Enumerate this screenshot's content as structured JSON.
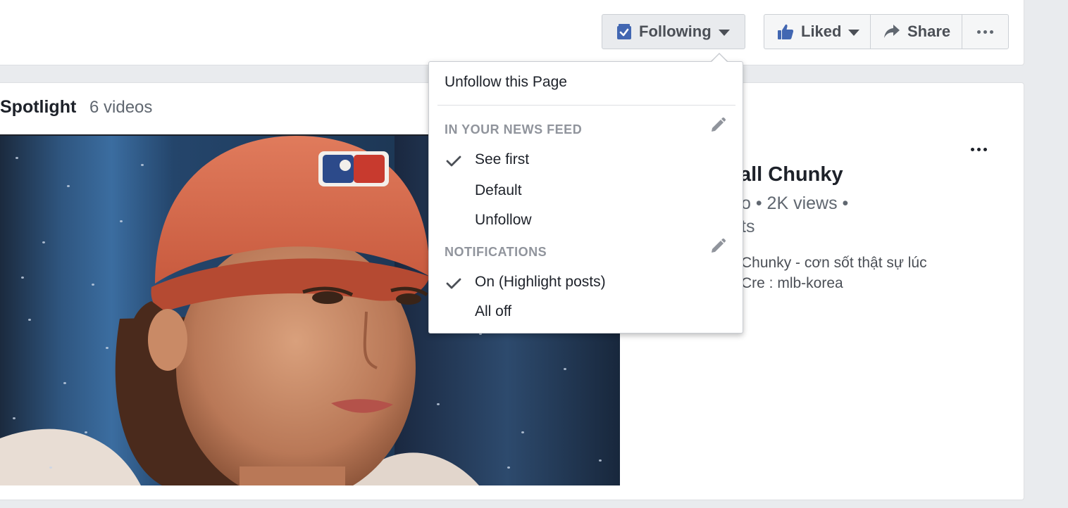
{
  "header": {
    "following_label": "Following",
    "liked_label": "Liked",
    "share_label": "Share"
  },
  "dropdown": {
    "unfollow_page": "Unfollow this Page",
    "news_feed_heading": "IN YOUR NEWS FEED",
    "news_feed_options": [
      "See first",
      "Default",
      "Unfollow"
    ],
    "news_feed_selected": "See first",
    "notifications_heading": "NOTIFICATIONS",
    "notification_options": [
      "On (Highlight posts)",
      "All off"
    ],
    "notification_selected": "On (Highlight posts)"
  },
  "spotlight": {
    "title": "Spotlight",
    "count": "6 videos"
  },
  "side_video": {
    "title": "all Chunky",
    "meta_line1": "o • 2K views •",
    "meta_line2": "ts",
    "desc_line1": "Chunky - cơn sốt thật sự lúc",
    "desc_line2": "Cre : mlb-korea"
  },
  "colors": {
    "accent": "#4267b2",
    "button_bg": "#f5f6f7",
    "text_secondary": "#606770",
    "heading_gray": "#90949c"
  }
}
